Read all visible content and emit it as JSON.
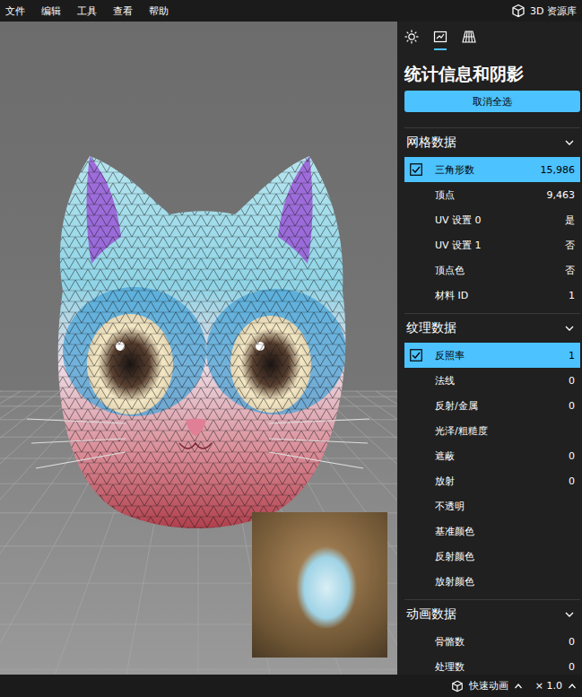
{
  "menu": [
    {
      "label": "文件"
    },
    {
      "label": "编辑"
    },
    {
      "label": "工具"
    },
    {
      "label": "查看"
    },
    {
      "label": "帮助"
    }
  ],
  "library_link": {
    "label": "3D 资源库"
  },
  "panel": {
    "tabs": [
      {
        "kind": "lighting",
        "selected": false
      },
      {
        "kind": "stats",
        "selected": true
      },
      {
        "kind": "grid",
        "selected": false
      }
    ],
    "title": "统计信息和阴影",
    "button": "取消全选",
    "sections": [
      {
        "title": "网格数据",
        "expanded": true,
        "rows": [
          {
            "label": "三角形数",
            "value": "15,986",
            "selected": true
          },
          {
            "label": "顶点",
            "value": "9,463",
            "selected": false
          },
          {
            "label": "UV 设置 0",
            "value": "是",
            "selected": false
          },
          {
            "label": "UV 设置 1",
            "value": "否",
            "selected": false
          },
          {
            "label": "顶点色",
            "value": "否",
            "selected": false
          },
          {
            "label": "材料 ID",
            "value": "1",
            "selected": false
          }
        ]
      },
      {
        "title": "纹理数据",
        "expanded": true,
        "rows": [
          {
            "label": "反照率",
            "value": "1",
            "selected": true
          },
          {
            "label": "法线",
            "value": "0",
            "selected": false
          },
          {
            "label": "反射/金属",
            "value": "0",
            "selected": false
          },
          {
            "label": "光泽/粗糙度",
            "value": "",
            "selected": false
          },
          {
            "label": "遮蔽",
            "value": "0",
            "selected": false
          },
          {
            "label": "放射",
            "value": "0",
            "selected": false
          },
          {
            "label": "不透明",
            "value": "",
            "selected": false
          },
          {
            "label": "基准颜色",
            "value": "",
            "selected": false
          },
          {
            "label": "反射颜色",
            "value": "",
            "selected": false
          },
          {
            "label": "放射颜色",
            "value": "",
            "selected": false
          }
        ]
      },
      {
        "title": "动画数据",
        "expanded": true,
        "rows": [
          {
            "label": "骨骼数",
            "value": "0",
            "selected": false
          },
          {
            "label": "处理数",
            "value": "0",
            "selected": false
          }
        ]
      }
    ]
  },
  "status_bar": {
    "animation": "快速动画",
    "speed": "× 1.0"
  }
}
